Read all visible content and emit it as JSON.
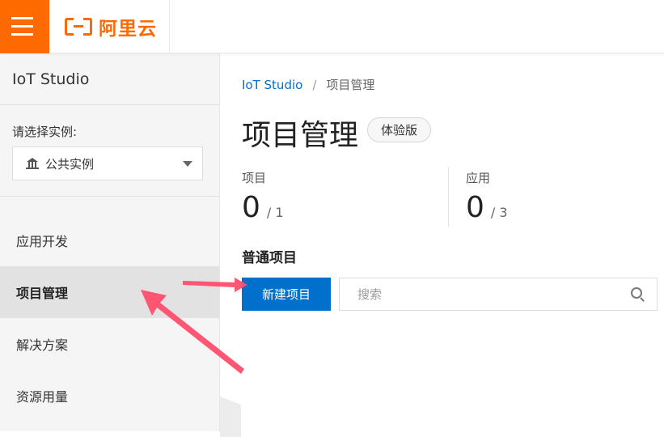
{
  "header": {
    "menu_icon": "hamburger-menu-icon",
    "logo_text": "阿里云",
    "brand_color": "#ff6a00"
  },
  "sidebar": {
    "title": "IoT Studio",
    "instance_label": "请选择实例:",
    "instance_value": "公共实例",
    "instance_icon": "bank-icon",
    "items": [
      {
        "label": "应用开发",
        "active": false
      },
      {
        "label": "项目管理",
        "active": true
      },
      {
        "label": "解决方案",
        "active": false
      },
      {
        "label": "资源用量",
        "active": false
      }
    ]
  },
  "main": {
    "breadcrumb": {
      "root": "IoT Studio",
      "separator": "/",
      "current": "项目管理"
    },
    "title": "项目管理",
    "badge": "体验版",
    "stats": [
      {
        "label": "项目",
        "value": "0",
        "total": "/ 1"
      },
      {
        "label": "应用",
        "value": "0",
        "total": "/ 3"
      }
    ],
    "section_title": "普通项目",
    "new_button": "新建项目",
    "search_placeholder": "搜索",
    "accent_color": "#0070cc"
  },
  "annotation_color": "#ff4d6d"
}
